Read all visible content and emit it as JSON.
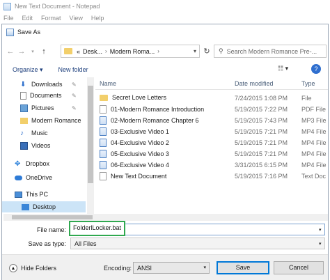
{
  "notepad": {
    "title": "New Text Document - Notepad",
    "menu": [
      "File",
      "Edit",
      "Format",
      "View",
      "Help"
    ]
  },
  "dialog": {
    "title": "Save As",
    "breadcrumb": [
      "«",
      "Desk...",
      "Modern Roma..."
    ],
    "search_placeholder": "Search Modern Romance Pre-...",
    "organize_label": "Organize ▾",
    "new_folder_label": "New folder",
    "help_label": "?",
    "nav": [
      {
        "label": "Downloads",
        "icon": "downloads-icon",
        "pinned": true
      },
      {
        "label": "Documents",
        "icon": "documents-icon",
        "pinned": true
      },
      {
        "label": "Pictures",
        "icon": "pictures-icon",
        "pinned": true
      },
      {
        "label": "Modern Romance",
        "icon": "folder-icon",
        "pinned": false
      },
      {
        "label": "Music",
        "icon": "music-icon",
        "pinned": false
      },
      {
        "label": "Videos",
        "icon": "videos-icon",
        "pinned": false
      },
      {
        "label": "Dropbox",
        "icon": "dropbox-icon",
        "pinned": false
      },
      {
        "label": "OneDrive",
        "icon": "onedrive-icon",
        "pinned": false
      },
      {
        "label": "This PC",
        "icon": "computer-icon",
        "pinned": false
      },
      {
        "label": "Desktop",
        "icon": "desktop-icon",
        "pinned": false
      }
    ],
    "columns": {
      "name": "Name",
      "date": "Date modified",
      "type": "Type"
    },
    "files": [
      {
        "name": "Secret Love Letters",
        "date": "7/24/2015 1:08 PM",
        "type": "File",
        "icon": "folder"
      },
      {
        "name": "01-Modern Romance Introduction",
        "date": "5/19/2015 7:22 PM",
        "type": "PDF File",
        "icon": "doc"
      },
      {
        "name": "02-Modern Romance Chapter 6",
        "date": "5/19/2015 7:43 PM",
        "type": "MP3 File",
        "icon": "media"
      },
      {
        "name": "03-Exclusive Video 1",
        "date": "5/19/2015 7:21 PM",
        "type": "MP4 File",
        "icon": "media"
      },
      {
        "name": "04-Exclusive Video 2",
        "date": "5/19/2015 7:21 PM",
        "type": "MP4 File",
        "icon": "media"
      },
      {
        "name": "05-Exclusive Video 3",
        "date": "5/19/2015 7:21 PM",
        "type": "MP4 File",
        "icon": "media"
      },
      {
        "name": "06-Exclusive Video 4",
        "date": "3/31/2015 6:15 PM",
        "type": "MP4 File",
        "icon": "media"
      },
      {
        "name": "New Text Document",
        "date": "5/19/2015 7:16 PM",
        "type": "Text Doc",
        "icon": "doc"
      }
    ],
    "file_name_label": "File name:",
    "file_name_value": "FolderlLocker.bat",
    "save_type_label": "Save as type:",
    "save_type_value": "All Files",
    "hide_folders_label": "Hide Folders",
    "encoding_label": "Encoding:",
    "encoding_value": "ANSI",
    "save_label": "Save",
    "cancel_label": "Cancel"
  }
}
